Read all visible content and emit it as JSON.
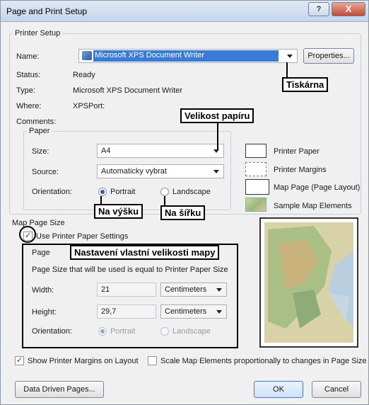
{
  "window": {
    "title": "Page and Print Setup",
    "help_glyph": "?",
    "close_glyph": "X"
  },
  "printer_setup": {
    "legend": "Printer Setup",
    "name_label": "Name:",
    "name_value": "Microsoft XPS Document Writer",
    "properties_button": "Properties...",
    "status_label": "Status:",
    "status_value": "Ready",
    "type_label": "Type:",
    "type_value": "Microsoft XPS Document Writer",
    "where_label": "Where:",
    "where_value": "XPSPort:",
    "comments_label": "Comments:"
  },
  "paper": {
    "legend": "Paper",
    "size_label": "Size:",
    "size_value": "A4",
    "source_label": "Source:",
    "source_value": "Automaticky vybrat",
    "orientation_label": "Orientation:",
    "portrait": "Portrait",
    "landscape": "Landscape",
    "selected": "Portrait"
  },
  "legend_items": [
    "Printer Paper",
    "Printer Margins",
    "Map Page (Page Layout)",
    "Sample Map Elements"
  ],
  "map_page_size": {
    "legend": "Map Page Size",
    "use_printer_paper": "Use Printer Paper Settings",
    "use_printer_paper_checked": true,
    "page_legend": "Page",
    "info": "Page Size that will be used is equal to Printer Paper Size",
    "width_label": "Width:",
    "width_value": "21",
    "width_unit": "Centimeters",
    "height_label": "Height:",
    "height_value": "29,7",
    "height_unit": "Centimeters",
    "orientation_label": "Orientation:",
    "portrait": "Portrait",
    "landscape": "Landscape"
  },
  "options": {
    "show_margins": "Show Printer Margins on Layout",
    "show_margins_checked": true,
    "scale_elements": "Scale Map Elements proportionally to changes in Page Size",
    "scale_elements_checked": false
  },
  "buttons": {
    "data_driven": "Data Driven Pages...",
    "ok": "OK",
    "cancel": "Cancel"
  },
  "annotations": {
    "tiskarna": "Tiskárna",
    "velikost_papiru": "Velikost papíru",
    "na_vysku": "Na výšku",
    "na_sirku": "Na šířku",
    "nastaveni": "Nastavení vlastní velikosti mapy"
  }
}
